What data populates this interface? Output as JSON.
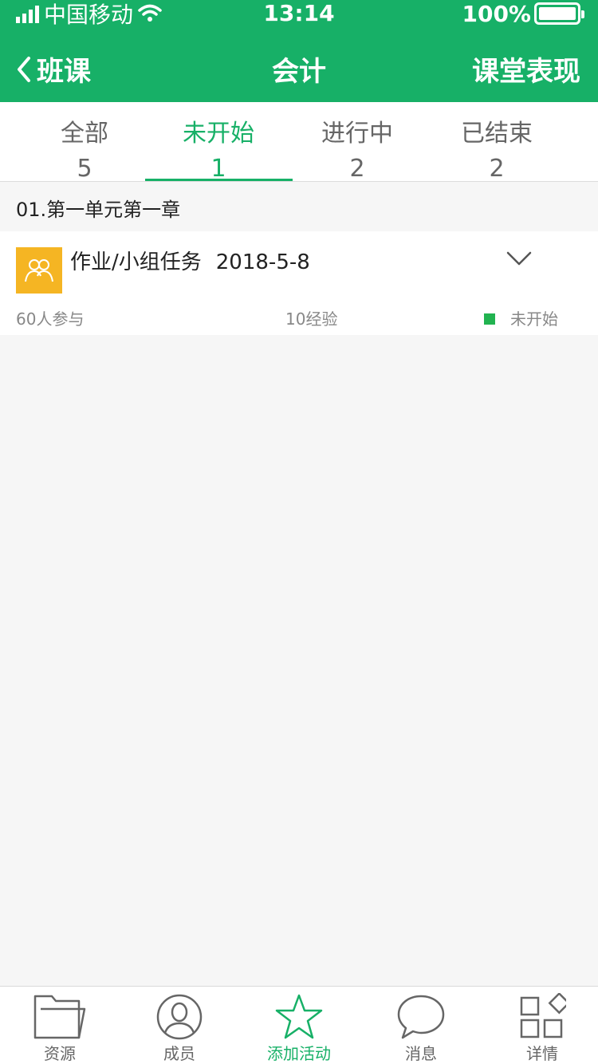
{
  "status": {
    "carrier": "中国移动",
    "time": "13:14",
    "battery": "100%"
  },
  "nav": {
    "back_label": "班课",
    "title": "会计",
    "right_label": "课堂表现"
  },
  "tabs": [
    {
      "label": "全部",
      "count": "5"
    },
    {
      "label": "未开始",
      "count": "1",
      "active": true
    },
    {
      "label": "进行中",
      "count": "2"
    },
    {
      "label": "已结束",
      "count": "2"
    }
  ],
  "section": {
    "header": "01.第一单元第一章"
  },
  "activity": {
    "title": "作业/小组任务",
    "date": "2018-5-8",
    "participants": "60人参与",
    "experience": "10经验",
    "status": "未开始",
    "icon": "group-icon",
    "avatar_color": "#f5b523",
    "status_color": "#22b350"
  },
  "bottom_tabs": [
    {
      "label": "资源",
      "icon": "folder-icon"
    },
    {
      "label": "成员",
      "icon": "person-icon"
    },
    {
      "label": "添加活动",
      "icon": "star-icon",
      "active": true
    },
    {
      "label": "消息",
      "icon": "chat-bubble-icon"
    },
    {
      "label": "详情",
      "icon": "grid-icon"
    }
  ],
  "colors": {
    "primary": "#17b067",
    "background": "#f6f6f6"
  }
}
